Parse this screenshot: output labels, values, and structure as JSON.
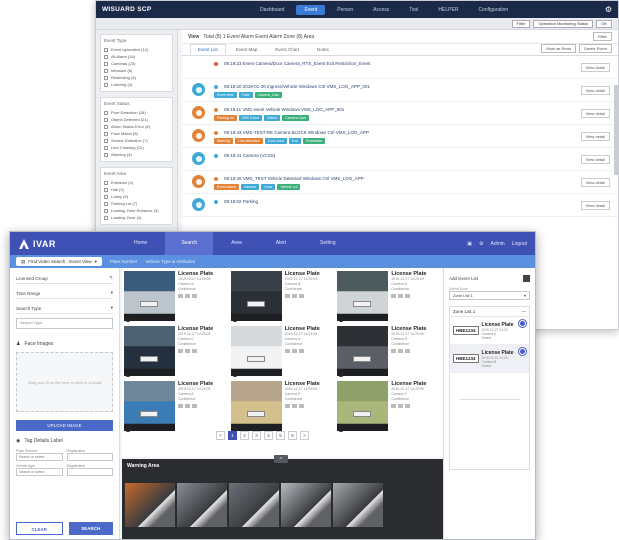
{
  "scp": {
    "title": "WISUARD SCP",
    "nav": [
      "Dashboard",
      "Event",
      "Person",
      "Access",
      "Tool",
      "HELPER",
      "Configuration"
    ],
    "active_nav": 1,
    "subbar_buttons": [
      "Filter",
      "Operation Monitoring Status",
      "OK"
    ],
    "sidebar_groups": [
      {
        "title": "Event Type",
        "items": [
          "Event Ignoration (12)",
          "All Alarm (34)",
          "Cameras (23)",
          "Intrusion (6)",
          "Restricting (8)",
          "Loitering (4)"
        ]
      },
      {
        "title": "Event Status",
        "items": [
          "Pure Detection (28)",
          "Object Detected (21)",
          "Alarm Status Error (8)",
          "Face Match (8)",
          "Sensor Detection (7)",
          "Line Crossing (12)",
          "Warning (4)"
        ]
      },
      {
        "title": "Event Area",
        "items": [
          "Entrance (4)",
          "Hall (3)",
          "Lobby (5)",
          "Parking Lot (7)",
          "Loading Zone Entrance (3)",
          "Loading Zone (4)"
        ]
      }
    ],
    "header_title": "View",
    "header_text": "Total (8)   1 Event Alarm  Event Alarm Zone (8) Area",
    "tabs": [
      "Event List",
      "Event Map",
      "Event Chart",
      "Notes"
    ],
    "tab_buttons": [
      "Mark as Read",
      "Delete Event"
    ],
    "top_right_btn": "Filter",
    "events": [
      {
        "color": "",
        "line": "09:19:23  Event Camera/Door  Camera_RTS_Event  Exit Restriction_Event",
        "tags": [],
        "view": "View detail"
      },
      {
        "color": "#3fa9d6",
        "line": "09:19:20  2019-01-30  Ingress/Vehicle  Windows Ctrl  VMS_LOG_APP_001",
        "tags": [
          [
            "Event time",
            "#3fa9d6"
          ],
          [
            "Plate",
            "#3fa9d6"
          ],
          [
            "Camera_Cam",
            "#3ab07a"
          ]
        ],
        "view": "View detail"
      },
      {
        "color": "#e2833a",
        "line": "09:19:11  VMS event  Vehicle  Windows  VMS_LOG_APP_001",
        "tags": [
          [
            "Parking lot",
            "#e2833a"
          ],
          [
            "VMS Event",
            "#3fa9d6"
          ],
          [
            "Detect",
            "#3fa9d6"
          ],
          [
            "Camera Cam",
            "#3ab07a"
          ]
        ],
        "view": "View detail"
      },
      {
        "color": "#e2833a",
        "line": "09:18:43  VMS-TEST-RE  Camera BLOCK  Windows Ctrl  VMS_LOG_APP",
        "tags": [
          [
            "Warning",
            "#e2833a"
          ],
          [
            "Line detection",
            "#e2833a"
          ],
          [
            "Zone Area",
            "#3fa9d6"
          ],
          [
            "Exit",
            "#3fa9d6"
          ],
          [
            "Pedestrian",
            "#3ab07a"
          ]
        ],
        "view": "View detail"
      },
      {
        "color": "#3fa9d6",
        "line": "09:18:41  Camera (VCSS)",
        "tags": [],
        "view": "View detail"
      },
      {
        "color": "#e2833a",
        "line": "09:18:26  VMS_TEST  Vehicle Detected  Windows Ctrl  VMS_LOG_APP",
        "tags": [
          [
            "Event Alarm",
            "#e2833a"
          ],
          [
            "Camera",
            "#3fa9d6"
          ],
          [
            "Zone",
            "#3fa9d6"
          ],
          [
            "Vehicle Lot",
            "#3ab07a"
          ]
        ],
        "view": "View detail"
      },
      {
        "color": "#3fa9d6",
        "line": "09:18:02  Parking",
        "tags": [],
        "view": "View detail"
      }
    ]
  },
  "ivar": {
    "logo": "IVAR",
    "nav": [
      "Home",
      "Search",
      "Area",
      "Alert",
      "Setting"
    ],
    "active_nav": 1,
    "top_right": [
      "Admin",
      "Logout"
    ],
    "sub_tab": "Find Video Search - Event View",
    "sub_segments": [
      "Plate Number",
      "Vehicle Type & Attributes"
    ],
    "left": {
      "fields": [
        "Licensed Group",
        "Time Range",
        "Search Type"
      ],
      "search_type_placeholder": "Search Type",
      "image_section": "Face Images",
      "image_hint": "Drag and Drop file here or click to Upload",
      "upload_label": "UPLOAD IMAGE",
      "filter_section": "Tag Details Label",
      "filter_labels": [
        "Plate Number",
        "Registration",
        "Vehicle type",
        "Registration"
      ],
      "filter_values": [
        "Search or select",
        "",
        "Search or select",
        ""
      ],
      "clear": "CLEAR",
      "search": "SEARCH"
    },
    "results": [
      {
        "title": "License Plate",
        "lines": [
          "2019-12-27 14:29:09",
          "Camera A",
          "Confidence"
        ],
        "bg": "#3b5b7a",
        "car": "#bcc4cc"
      },
      {
        "title": "License Plate",
        "lines": [
          "2019-12-27 14:29:09",
          "Camera B",
          "Confidence"
        ],
        "bg": "#3a4048",
        "car": "#2b2f36"
      },
      {
        "title": "License Plate",
        "lines": [
          "2019-12-27 14:29:09",
          "Camera A",
          "Confidence"
        ],
        "bg": "#4d5a5e",
        "car": "#cfd5d6"
      },
      {
        "title": "License Plate",
        "lines": [
          "2019-12-27 14:29:09",
          "Camera C",
          "Confidence"
        ],
        "bg": "#4e6272",
        "car": "#25303f"
      },
      {
        "title": "License Plate",
        "lines": [
          "2019-12-27 14:29:09",
          "Camera A",
          "Confidence"
        ],
        "bg": "#d6dadd",
        "car": "#f2f3f4"
      },
      {
        "title": "License Plate",
        "lines": [
          "2019-12-27 14:29:09",
          "Camera D",
          "Confidence"
        ],
        "bg": "#2d3136",
        "car": "#5a5f66"
      },
      {
        "title": "License Plate",
        "lines": [
          "2019-12-27 14:29:09",
          "Camera A",
          "Confidence"
        ],
        "bg": "#6f8798",
        "car": "#3b7cb5"
      },
      {
        "title": "License Plate",
        "lines": [
          "2019-12-27 14:29:09",
          "Camera E",
          "Confidence"
        ],
        "bg": "#b7a58c",
        "car": "#d3c08c"
      },
      {
        "title": "License Plate",
        "lines": [
          "2019-12-27 14:29:09",
          "Camera F",
          "Confidence"
        ],
        "bg": "#8fa06b",
        "car": "#a9b77a"
      }
    ],
    "pager": [
      "<",
      "1",
      "2",
      "3",
      "4",
      "5",
      "6",
      ">"
    ],
    "pager_active": 1,
    "warning_title": "Warning Area",
    "warning_handle": "=",
    "warning_thumbs": [
      "#c96a2a",
      "#8a8f96",
      "#6c7178",
      "#b8bcc0",
      "#a7a9ab"
    ],
    "right": {
      "title": "Add Event List",
      "sel_label": "Select Zone",
      "sel_value": "Zone List 1",
      "list_title": "Zone List 1",
      "list_icon": "—",
      "items": [
        {
          "plate": "HBE1234",
          "title": "License Plate",
          "lines": [
            "2019-12-27 14:29",
            "Camera A",
            "Detect"
          ],
          "selected": false
        },
        {
          "plate": "HBE1234",
          "title": "License Plate",
          "lines": [
            "2019-12-27 14:29",
            "Camera B",
            "Detect"
          ],
          "selected": true
        }
      ]
    }
  }
}
